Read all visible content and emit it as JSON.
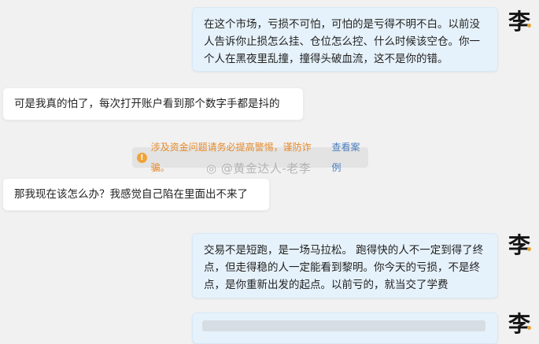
{
  "messages": [
    {
      "id": "m1",
      "side": "right",
      "text": "在这个市场，亏损不可怕，可怕的是亏得不明不白。以前没人告诉你止损怎么挂、仓位怎么控、什么时候该空仓。你一个人在黑夜里乱撞，撞得头破血流，这不是你的错。"
    },
    {
      "id": "m2",
      "side": "left",
      "text": "可是我真的怕了，每次打开账户看到那个数字手都是抖的"
    },
    {
      "id": "m3",
      "side": "left",
      "text": "那我现在该怎么办？我感觉自己陷在里面出不来了"
    },
    {
      "id": "m4",
      "side": "right",
      "text": "交易不是短跑，是一场马拉松。 跑得快的人不一定到得了终点，但走得稳的人一定能看到黎明。你今天的亏损，不是终点，是你重新出发的起点。以前亏的，就当交了学费"
    }
  ],
  "avatar": {
    "char": "李"
  },
  "notice": {
    "text": "涉及资金问题请务必提高警惕，谨防诈骗。",
    "link": "查看案例"
  },
  "watermark": "@黄金达人-老李",
  "colors": {
    "right_bubble": "#e6f2fb",
    "left_bubble": "#ffffff",
    "notice_text": "#e58a2c",
    "link": "#4b7fbf"
  }
}
